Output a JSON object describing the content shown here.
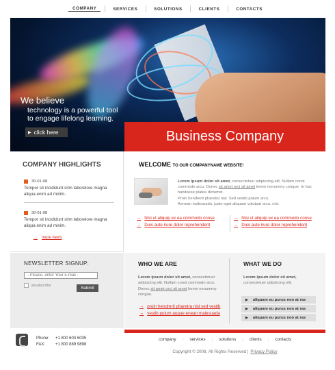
{
  "nav": {
    "items": [
      "COMPANY",
      "SERVICES",
      "SOLUTIONS",
      "CLIENTS",
      "CONTACTS"
    ]
  },
  "hero": {
    "tagline_1": "We believe",
    "tagline_2": "technology is a powerful tool",
    "tagline_3": "to engage lifelong learning.",
    "click_label": "click here",
    "banner": "Business Company"
  },
  "highlights": {
    "title": "COMPANY HIGHLIGHTS",
    "items": [
      {
        "date": "30-01-08",
        "text": "Tempor sit incididunt sitm laborelore magna aliqua enim ad minim."
      },
      {
        "date": "30-01-08",
        "text": "Tempor sit incididunt sitm laborelore magna aliqua enim ad minim."
      }
    ],
    "more_label": "more news"
  },
  "welcome": {
    "title": "WELCOME",
    "title_small": "TO OUR COMPANYNAME WEBSITE!",
    "lead": "Lorem ipsum dolor sit amet,",
    "text_1": " consectetuer adipiscing elit. Nullam const commodo arcu. Donec ",
    "link_1": "sit amet orci sit amet",
    "text_2": " lorem nonummy congue. In hac habitasse platea dictumst.",
    "text_3": "Proin hendrerit pharetra nisl. Sed vestib pulum arcu.",
    "text_4": "Aenean malesuada, justo eget aliquam volutpat arcu. nisl.",
    "links_left": [
      "Nisi ut aliquip ex ea commodo conse",
      "Duis aute irure dolor  reprehenderit"
    ],
    "links_right": [
      "Nisi ut aliquip ex ea commodo conse",
      "Duis aute irure dolor  reprehenderit"
    ]
  },
  "newsletter": {
    "title": "NEWSLETTER SIGNUP:",
    "placeholder": "- Please, enter Your e-mail -",
    "unsubscribe": "unsubscribe",
    "submit": "Submit"
  },
  "who": {
    "title": "WHO WE ARE",
    "lead": "Lorem ipsum dolor sit amet,",
    "text_1": " consectetuer adipiscing elit. Nullam const commodo arcu. Donec ",
    "link_1": "sit amet orci sit amet",
    "text_2": " lorem nonummy congue.",
    "links": [
      "proin hendrerit pharetra nisl sed vestib",
      "vestib pulum augue  enean malesuada"
    ]
  },
  "what": {
    "title": "WHAT WE DO",
    "lead": "Lorem ipsum dolor sit amet,",
    "text": " consectetuer adipiscing elit.",
    "bars": [
      "aliquam eu purus non at ras",
      "aliquam eu purus non at ras",
      "aliquam eu purus non at ras"
    ]
  },
  "contact": {
    "phone_label": "Phone:",
    "phone": "+1 800 603 6035",
    "fax_label": "FAX:",
    "fax": "+1 800 889 9898"
  },
  "footer": {
    "nav": [
      "company",
      "services",
      "solutions",
      "clients",
      "contacts"
    ],
    "copyright": "Copyright © 2008, All Rights Reserved  |",
    "privacy": "Privacy Policy"
  },
  "colors": {
    "accent": "#d9261c",
    "dark": "#333333"
  }
}
